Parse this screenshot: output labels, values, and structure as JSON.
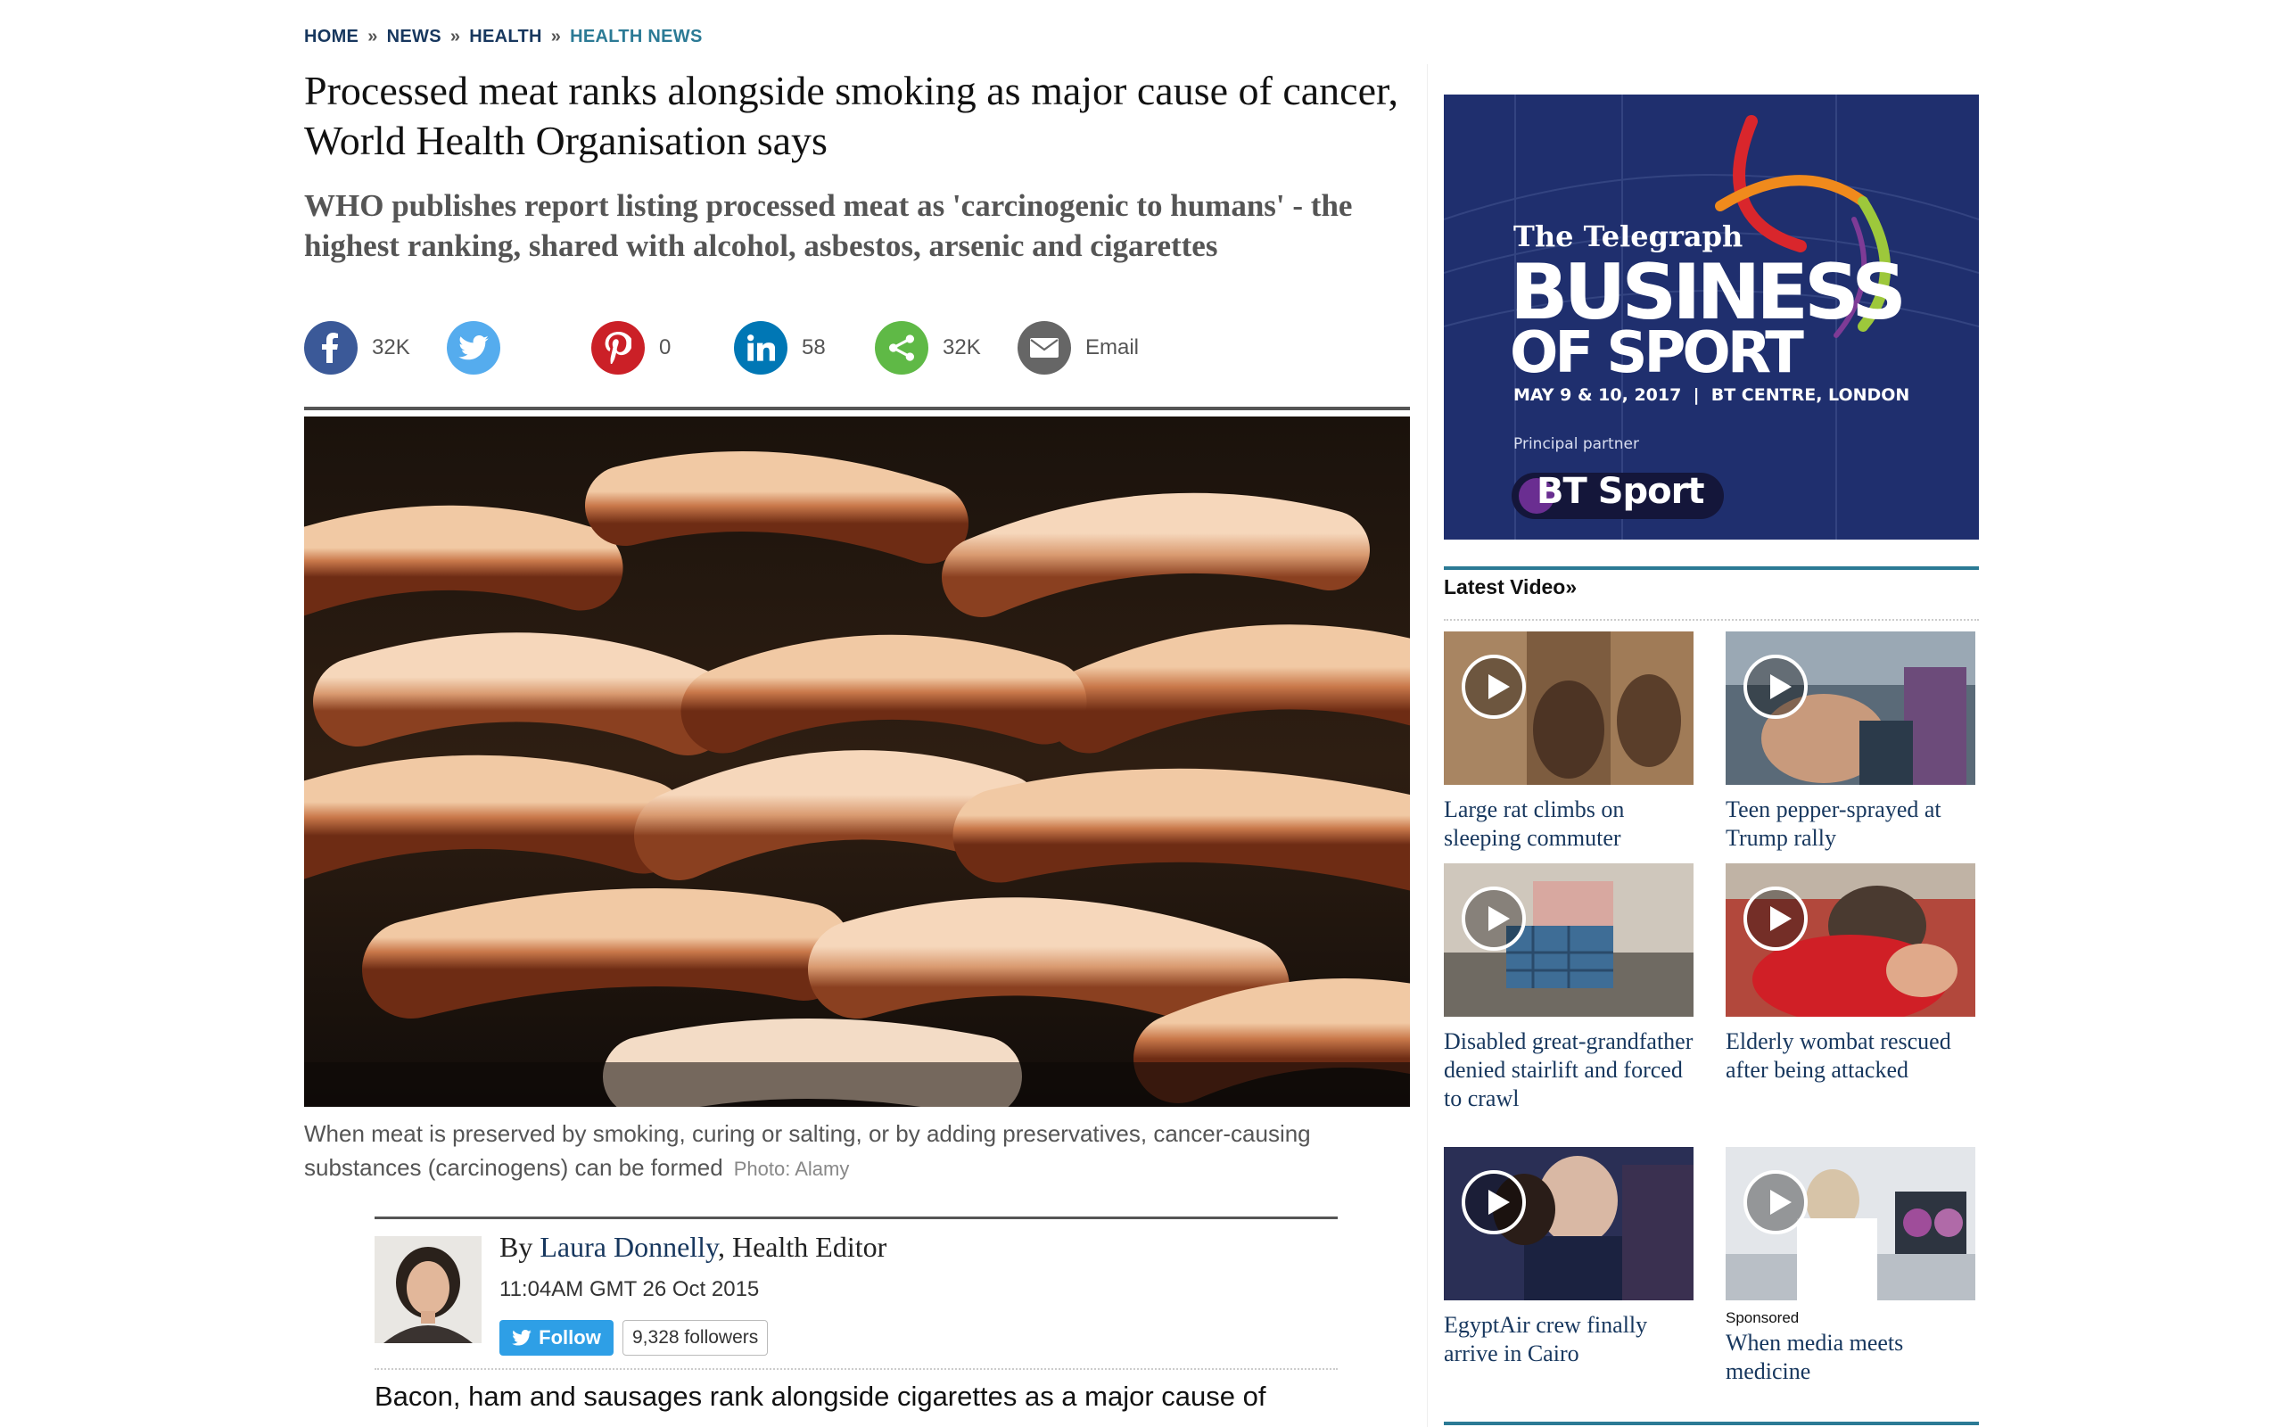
{
  "breadcrumb": [
    "HOME",
    "NEWS",
    "HEALTH",
    "HEALTH NEWS"
  ],
  "article": {
    "headline": "Processed meat ranks alongside smoking as major cause of cancer, World Health Organisation says",
    "standfirst": "WHO publishes report listing processed meat as 'carcinogenic to humans' - the highest ranking, shared with alcohol, asbestos, arsenic and cigarettes",
    "caption": "When meat is preserved by smoking, curing or salting, or by adding preservatives, cancer-causing substances (carcinogens) can be formed",
    "photo_credit": "Photo: Alamy",
    "byline_prefix": "By ",
    "author": "Laura Donnelly",
    "author_role": ", Health Editor",
    "timestamp": "11:04AM GMT 26 Oct 2015",
    "follow_label": "Follow",
    "followers": "9,328 followers",
    "body_first_line": "Bacon, ham and sausages rank alongside cigarettes as a major cause of"
  },
  "share": {
    "facebook_count": "32K",
    "pinterest_count": "0",
    "linkedin_count": "58",
    "share_count": "32K",
    "email_label": "Email",
    "colors": {
      "facebook": "#3b5998",
      "twitter": "#55acee",
      "pinterest": "#cb2027",
      "linkedin": "#0077b5",
      "share": "#5fb946",
      "email": "#666666"
    }
  },
  "ad": {
    "brand": "The Telegraph",
    "line1": "BUSINESS",
    "line2": "OF SPORT",
    "dates": "MAY 9 & 10, 2017  |  BT CENTRE, LONDON",
    "partner_label": "Principal partner",
    "partner": "BT Sport"
  },
  "latest_video": {
    "title": "Latest Video»",
    "videos": [
      {
        "title": "Large rat climbs on sleeping commuter"
      },
      {
        "title": "Teen pepper-sprayed at Trump rally"
      },
      {
        "title": "Disabled great-grandfather denied stairlift and forced to crawl"
      },
      {
        "title": "Elderly wombat rescued after being attacked"
      },
      {
        "title": "EgyptAir crew finally arrive in Cairo"
      },
      {
        "title": "When media meets medicine",
        "sponsored": "Sponsored"
      }
    ]
  }
}
